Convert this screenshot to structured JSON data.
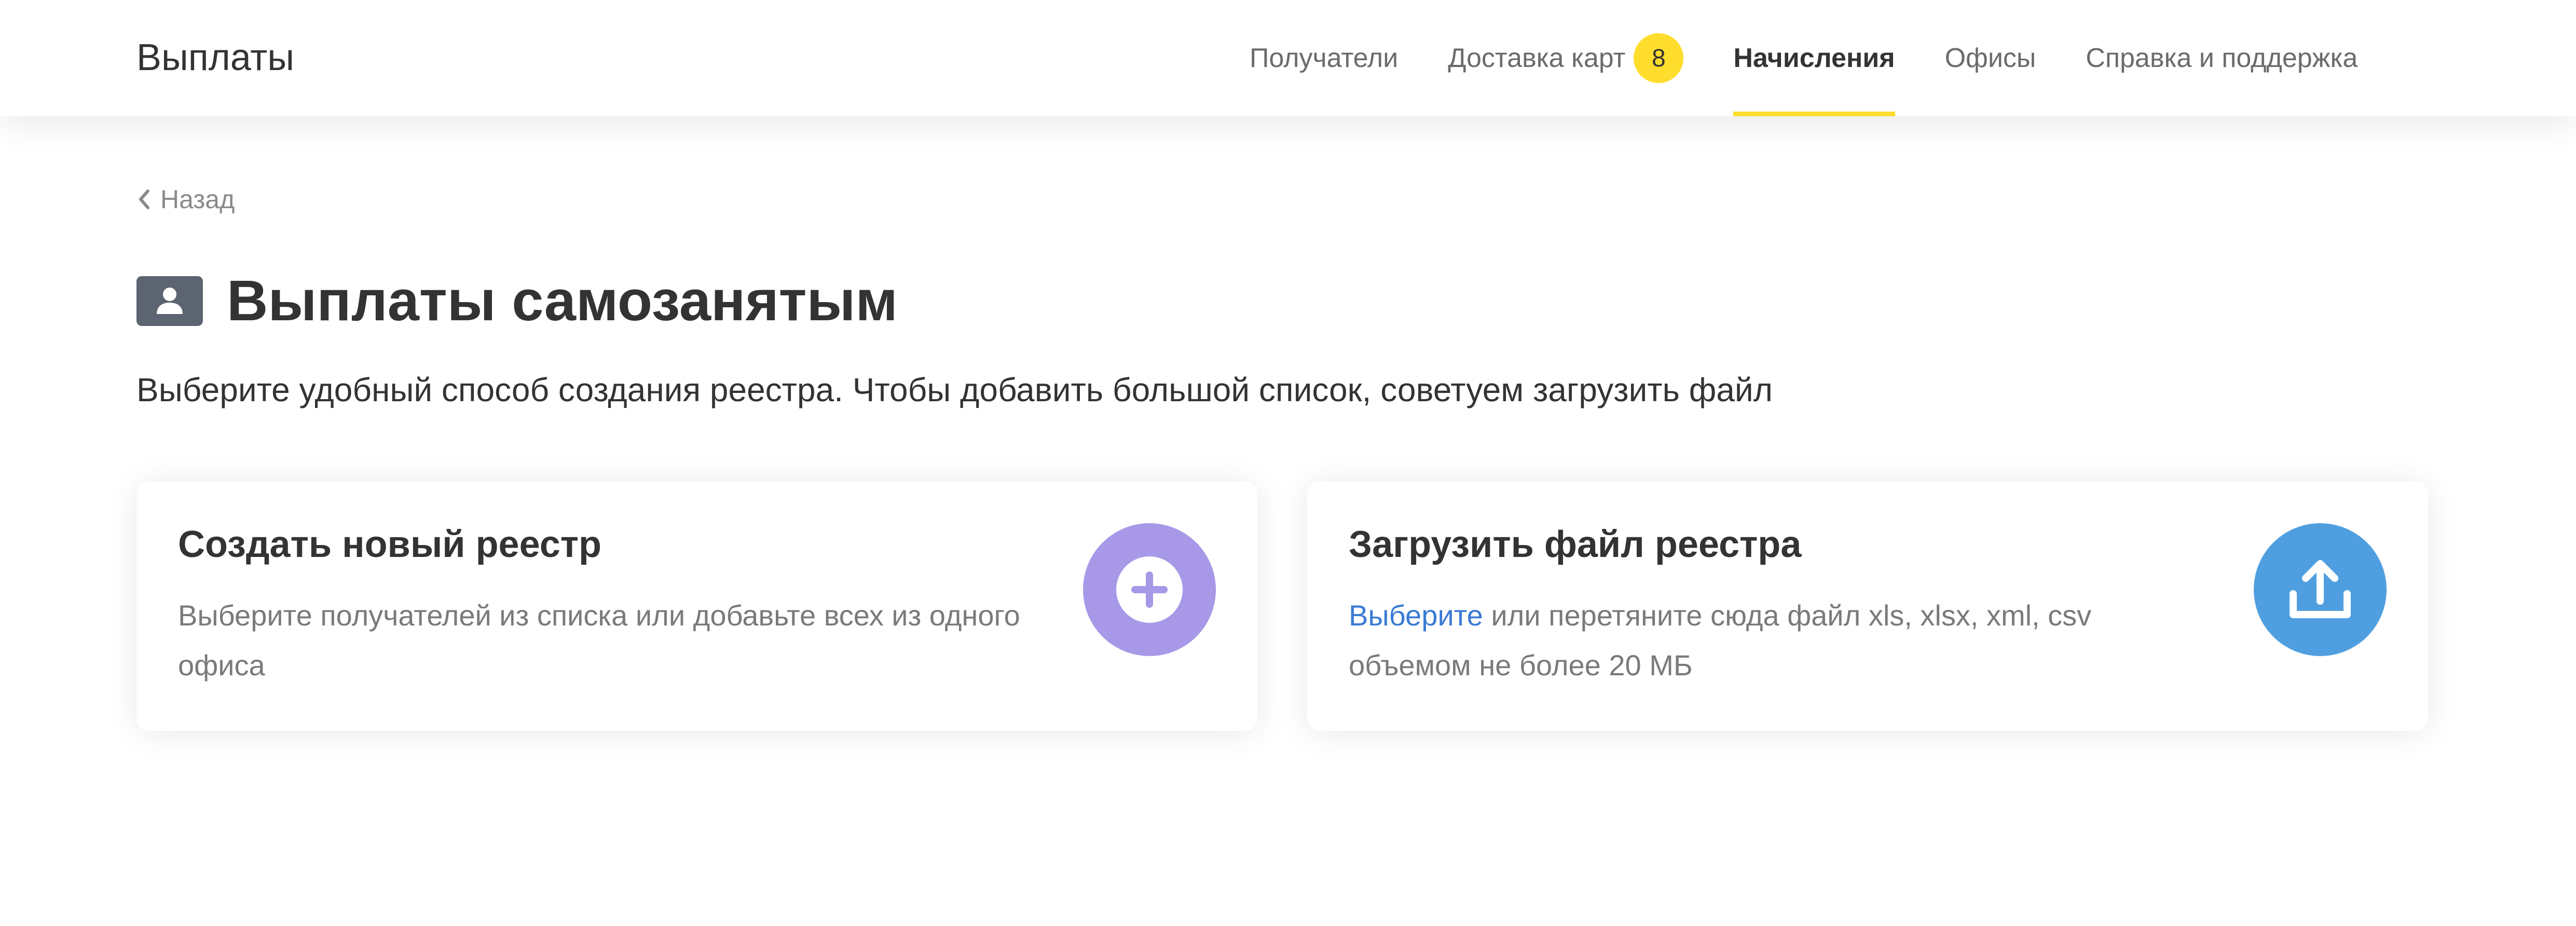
{
  "header": {
    "app_title": "Выплаты",
    "nav": [
      {
        "label": "Получатели"
      },
      {
        "label": "Доставка карт",
        "badge": "8"
      },
      {
        "label": "Начисления",
        "active": true
      },
      {
        "label": "Офисы"
      },
      {
        "label": "Справка и поддержка"
      }
    ]
  },
  "back": {
    "label": "Назад",
    "icon": "chevron-left-icon"
  },
  "page": {
    "icon": "user-card-icon",
    "title": "Выплаты самозанятым",
    "subtitle": "Выберите удобный способ создания реестра. Чтобы добавить большой список, советуем загрузить файл"
  },
  "cards": {
    "create": {
      "title": "Создать новый реестр",
      "text": "Выберите получателей из списка или добавьте всех из одного офиса",
      "icon": "plus-icon",
      "icon_bg": "#a898e8"
    },
    "upload": {
      "title": "Загрузить файл реестра",
      "link": "Выберите",
      "text": " или перетяните сюда файл xls, xlsx, xml, csv объемом не более 20 МБ",
      "icon": "upload-icon",
      "icon_bg": "#4f9fe0"
    }
  },
  "colors": {
    "accent_yellow": "#ffdd2d",
    "link_blue": "#3a7bd5",
    "text_primary": "#333333",
    "text_secondary": "#7a7a7a"
  }
}
